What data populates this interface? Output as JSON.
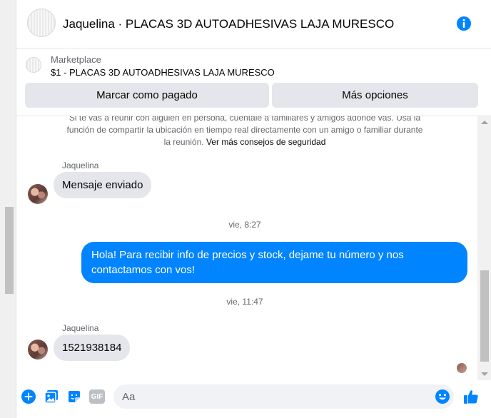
{
  "header": {
    "title": "Jaquelina · PLACAS 3D AUTOADHESIVAS LAJA MURESCO",
    "info_icon": "info-icon"
  },
  "marketplace": {
    "label": "Marketplace",
    "item": "$1 - PLACAS 3D AUTOADHESIVAS LAJA MURESCO",
    "mark_paid": "Marcar como pagado",
    "more_options": "Más opciones"
  },
  "safety_notice": {
    "text": "Si te vas a reunir con alguien en persona, cuéntale a familiares y amigos adónde vas. Usa la función de compartir la ubicación en tiempo real directamente con un amigo o familiar durante la reunión.",
    "link": "Ver más consejos de seguridad"
  },
  "messages": [
    {
      "sender": "Jaquelina",
      "text": "Mensaje enviado"
    },
    {
      "timestamp": "vie, 8:27"
    },
    {
      "sender": "me",
      "text": "Hola! Para recibir info de precios y stock, dejame tu número y nos contactamos con vos!"
    },
    {
      "timestamp": "vie, 11:47"
    },
    {
      "sender": "Jaquelina",
      "text": "1521938184"
    }
  ],
  "composer": {
    "placeholder": "Aa",
    "icons": [
      "plus-icon",
      "image-icon",
      "sticker-icon",
      "gif-icon",
      "emoji-icon",
      "like-icon"
    ],
    "gif_label": "GIF"
  },
  "colors": {
    "accent": "#0084ff",
    "bubble_in": "#e4e6eb",
    "secondary_text": "#65676b"
  }
}
